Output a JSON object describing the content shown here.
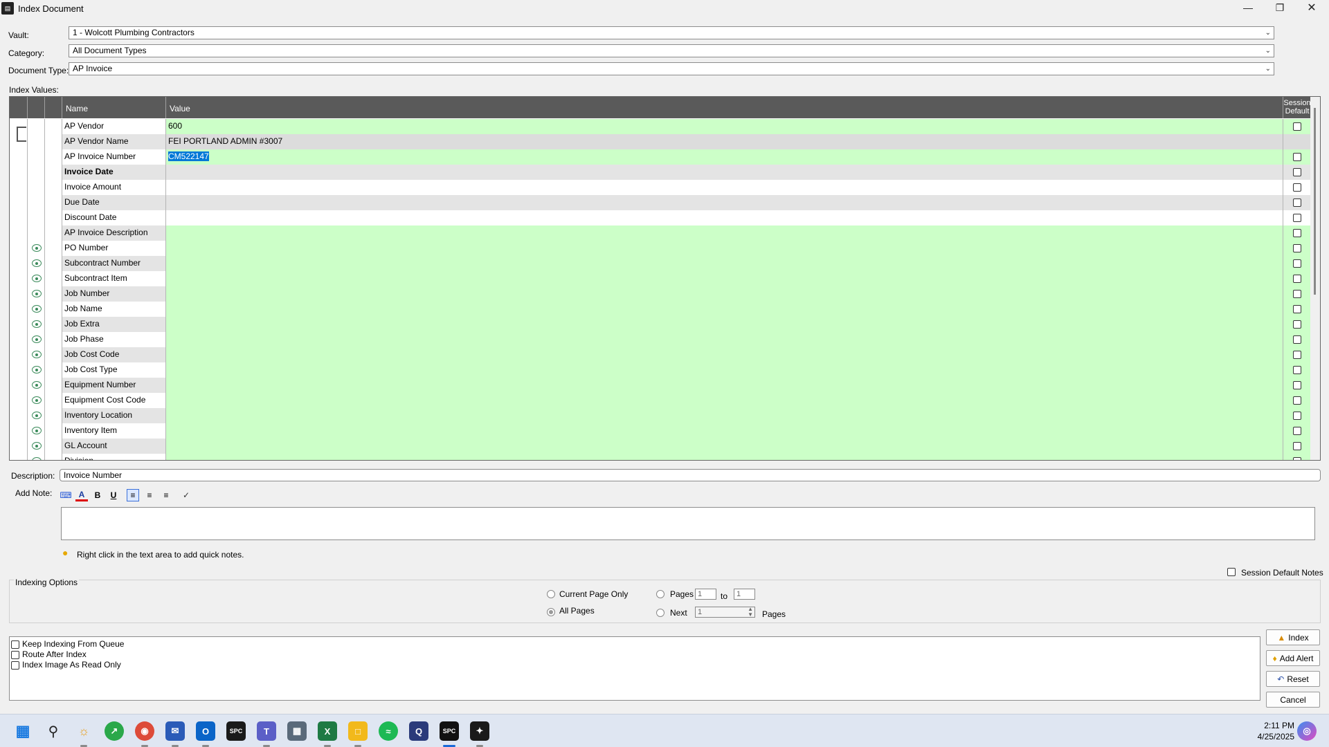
{
  "window": {
    "title": "Index Document",
    "app_icon": "spc-icon"
  },
  "form": {
    "vault_label": "Vault:",
    "vault_value": "1 - Wolcott Plumbing Contractors",
    "category_label": "Category:",
    "category_value": "All Document Types",
    "doctype_label": "Document Type:",
    "doctype_value": "AP Invoice",
    "index_values_label": "Index Values:"
  },
  "grid": {
    "col_name": "Name",
    "col_value": "Value",
    "col_default_line1": "Session",
    "col_default_line2": "Default",
    "rows": [
      {
        "name": "AP Vendor",
        "value": "600",
        "bg": "#ccffc8",
        "eye": false,
        "check": true,
        "bold": false
      },
      {
        "name": "AP Vendor Name",
        "value": "FEI PORTLAND ADMIN #3007",
        "bg": "#dcdcdc",
        "eye": false,
        "check": false,
        "bold": false
      },
      {
        "name": "AP Invoice Number",
        "value": "CM522147",
        "bg": "#ccffc8",
        "eye": false,
        "check": true,
        "bold": false,
        "selected": true
      },
      {
        "name": "Invoice Date",
        "value": "",
        "bg": "#e4e4e4",
        "eye": false,
        "check": true,
        "bold": true
      },
      {
        "name": "Invoice Amount",
        "value": "",
        "bg": "#ffffff",
        "eye": false,
        "check": true,
        "bold": false
      },
      {
        "name": "Due Date",
        "value": "",
        "bg": "#e4e4e4",
        "eye": false,
        "check": true,
        "bold": false
      },
      {
        "name": "Discount Date",
        "value": "",
        "bg": "#ffffff",
        "eye": false,
        "check": true,
        "bold": false
      },
      {
        "name": "AP Invoice Description",
        "value": "",
        "bg": "#ccffc8",
        "eye": false,
        "check": true,
        "bold": false
      },
      {
        "name": "PO Number",
        "value": "",
        "bg": "#ccffc8",
        "eye": true,
        "check": true,
        "bold": false
      },
      {
        "name": "Subcontract Number",
        "value": "",
        "bg": "#ccffc8",
        "eye": true,
        "check": true,
        "bold": false
      },
      {
        "name": "Subcontract Item",
        "value": "",
        "bg": "#ccffc8",
        "eye": true,
        "check": true,
        "bold": false
      },
      {
        "name": "Job Number",
        "value": "",
        "bg": "#ccffc8",
        "eye": true,
        "check": true,
        "bold": false
      },
      {
        "name": "Job Name",
        "value": "",
        "bg": "#ccffc8",
        "eye": true,
        "check": true,
        "bold": false
      },
      {
        "name": "Job Extra",
        "value": "",
        "bg": "#ccffc8",
        "eye": true,
        "check": true,
        "bold": false
      },
      {
        "name": "Job Phase",
        "value": "",
        "bg": "#ccffc8",
        "eye": true,
        "check": true,
        "bold": false
      },
      {
        "name": "Job Cost Code",
        "value": "",
        "bg": "#ccffc8",
        "eye": true,
        "check": true,
        "bold": false
      },
      {
        "name": "Job Cost Type",
        "value": "",
        "bg": "#ccffc8",
        "eye": true,
        "check": true,
        "bold": false
      },
      {
        "name": "Equipment Number",
        "value": "",
        "bg": "#ccffc8",
        "eye": true,
        "check": true,
        "bold": false
      },
      {
        "name": "Equipment Cost Code",
        "value": "",
        "bg": "#ccffc8",
        "eye": true,
        "check": true,
        "bold": false
      },
      {
        "name": "Inventory Location",
        "value": "",
        "bg": "#ccffc8",
        "eye": true,
        "check": true,
        "bold": false
      },
      {
        "name": "Inventory Item",
        "value": "",
        "bg": "#ccffc8",
        "eye": true,
        "check": true,
        "bold": false
      },
      {
        "name": "GL Account",
        "value": "",
        "bg": "#ccffc8",
        "eye": true,
        "check": true,
        "bold": false
      },
      {
        "name": "Division",
        "value": "",
        "bg": "#ccffc8",
        "eye": true,
        "check": true,
        "bold": false
      }
    ]
  },
  "description": {
    "label": "Description:",
    "value": "Invoice Number"
  },
  "note": {
    "label": "Add Note:",
    "tip": "Right click in the text area to add quick notes.",
    "session_default_notes": "Session Default Notes"
  },
  "indexing": {
    "label": "Indexing Options",
    "current_page": "Current Page Only",
    "all_pages": "All Pages",
    "pages": "Pages",
    "pages_from": "1",
    "to": "to",
    "pages_to": "1",
    "next": "Next",
    "next_value": "1",
    "pages_suffix": "Pages"
  },
  "options": {
    "keep_indexing": "Keep Indexing From Queue",
    "route_after": "Route After Index",
    "read_only": "Index Image As Read Only"
  },
  "buttons": {
    "index": "Index",
    "add_alert": "Add Alert",
    "reset": "Reset",
    "cancel": "Cancel"
  },
  "taskbar": {
    "time": "2:11 PM",
    "date": "4/25/2025"
  }
}
